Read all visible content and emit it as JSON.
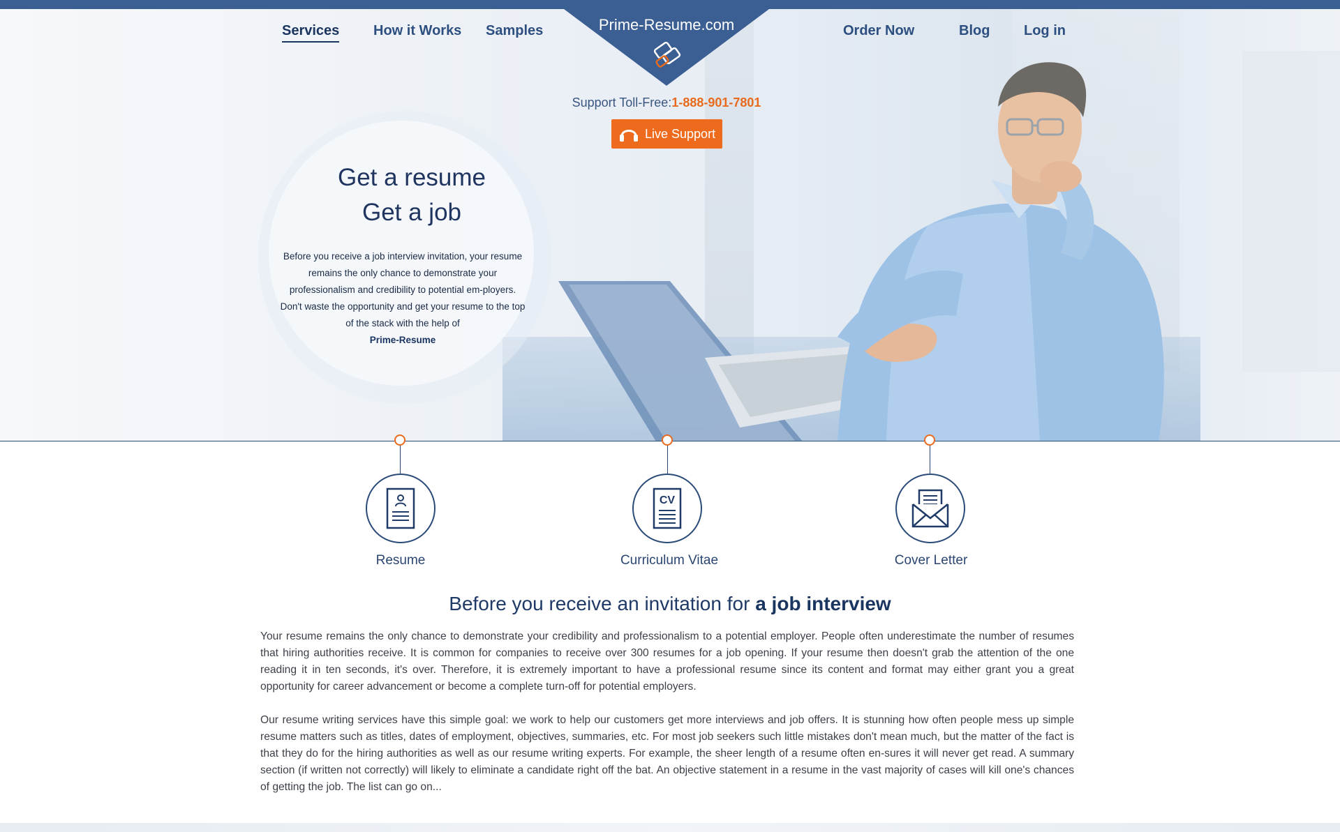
{
  "nav": {
    "left": [
      {
        "label": "Services",
        "active": true
      },
      {
        "label": "How it Works"
      },
      {
        "label": "Samples"
      }
    ],
    "right": [
      {
        "label": "Order Now"
      },
      {
        "label": "Blog"
      },
      {
        "label": "Log in"
      }
    ]
  },
  "logo": {
    "text": "Prime-Resume.com",
    "icon": "handshake-icon"
  },
  "support": {
    "label": "Support Toll-Free:",
    "phone": "1-888-901-7801"
  },
  "live_support": {
    "label": "Live Support",
    "icon": "headset-icon"
  },
  "hero": {
    "line1": "Get a resume",
    "line2": "Get a job",
    "description": "Before you receive a job interview invitation, your resume remains the only chance to demonstrate your professionalism and credibility to potential em-ployers. Don't waste the opportunity and get your resume to the top of the stack with the help of",
    "brand": "Prime-Resume"
  },
  "services": [
    {
      "label": "Resume",
      "icon": "resume-document-icon"
    },
    {
      "label": "Curriculum Vitae",
      "icon": "cv-document-icon",
      "icon_text": "CV"
    },
    {
      "label": "Cover Letter",
      "icon": "envelope-letter-icon"
    }
  ],
  "section": {
    "title_plain": "Before you receive an invitation for ",
    "title_bold": "a job interview",
    "paragraph1": "Your resume remains the only chance to demonstrate your credibility and professionalism to a potential employer. People often underestimate the number of resumes that hiring authorities receive. It is common for companies to receive over 300 resumes for a job opening. If your resume then doesn't grab the attention of the one reading it in ten seconds, it's over. Therefore, it is extremely important to have a professional resume since its content and format may either grant you a great opportunity for career advancement or become a complete turn-off for potential employers.",
    "paragraph2": "Our resume writing services have this simple goal: we work to help our customers get more interviews and job offers. It is stunning how often people mess up simple resume matters such as titles, dates of employment, objectives, summaries, etc. For most job seekers such little mistakes don't mean much, but the matter of the fact is that they do for the hiring authorities as well as our resume writing experts. For example, the sheer length of a resume often en-sures it will never get read. A summary section (if written not correctly) will likely to eliminate a candidate right off the bat. An objective statement in a resume in the vast majority of cases will kill one's chances of getting the job. The list can go on..."
  },
  "colors": {
    "primary": "#3b5e93",
    "accent": "#ee6b1d",
    "text_dark": "#1f3560"
  }
}
